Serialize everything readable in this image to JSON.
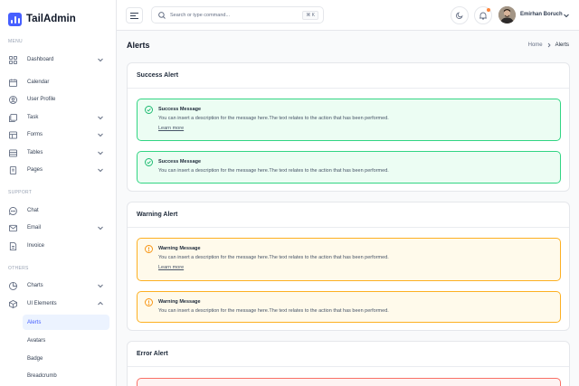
{
  "brand": {
    "name": "TailAdmin"
  },
  "sidebar": {
    "menu_label": "MENU",
    "support_label": "SUPPORT",
    "others_label": "OTHERS",
    "menu_items": [
      "Dashboard",
      "Calendar",
      "User Profile",
      "Task",
      "Forms",
      "Tables",
      "Pages"
    ],
    "support_items": [
      "Chat",
      "Email",
      "Invoice"
    ],
    "others_items": [
      "Charts",
      "UI Elements"
    ],
    "sub_items": [
      "Alerts",
      "Avatars",
      "Badge",
      "Breadcrumb"
    ]
  },
  "header": {
    "search_placeholder": "Search or type command...",
    "shortcut": "⌘ K",
    "user_name": "Emirhan Boruch"
  },
  "page": {
    "title": "Alerts",
    "breadcrumb_home": "Home",
    "breadcrumb_current": "Alerts"
  },
  "sections": {
    "success_title": "Success Alert",
    "warning_title": "Warning Alert",
    "error_title": "Error Alert"
  },
  "alerts": {
    "success_title": "Success Message",
    "warning_title": "Warning Message",
    "description": "You can insert a description for the message here.The text relates to the action that has been performed.",
    "link": "Learn more"
  },
  "colors": {
    "primary": "#465fff",
    "success": "#12b76a",
    "warning": "#f79009",
    "error": "#f04438"
  }
}
